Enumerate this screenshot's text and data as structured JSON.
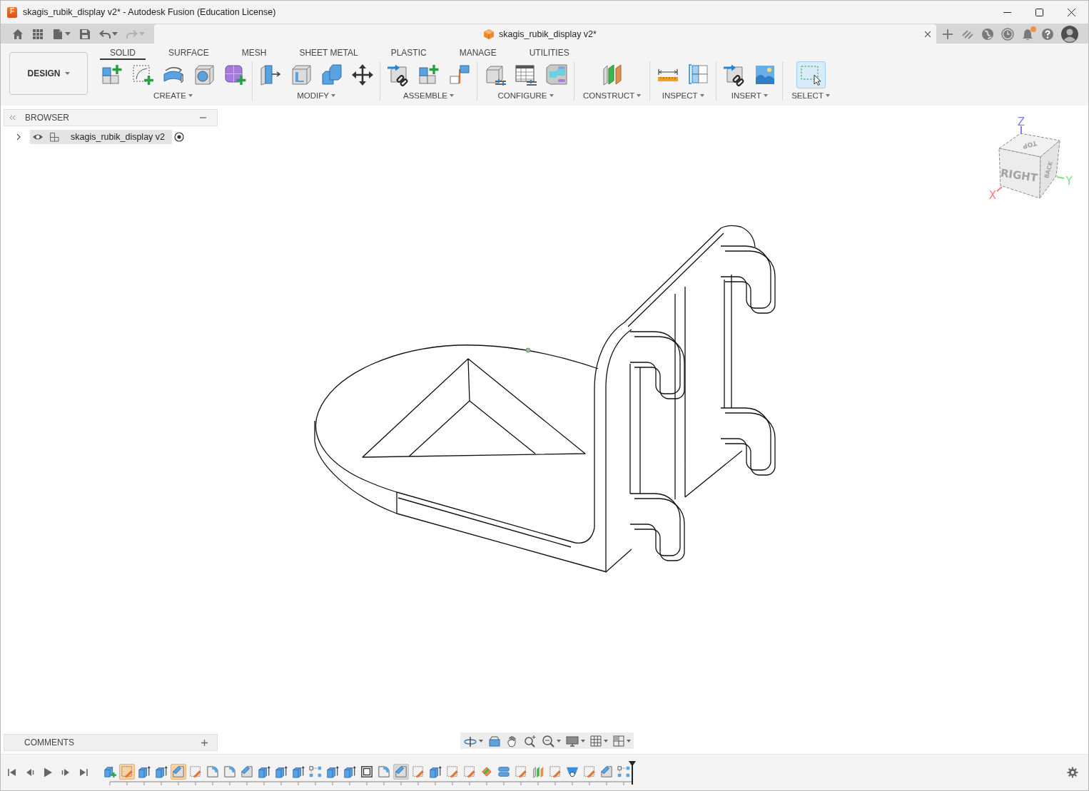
{
  "window": {
    "title": "skagis_rubik_display v2* - Autodesk Fusion (Education License)",
    "icon_letter": "F"
  },
  "quick_access": {
    "undo": {
      "disabled": false
    },
    "redo": {
      "disabled": true
    }
  },
  "document_tab": {
    "title": "skagis_rubik_display v2*"
  },
  "notifications": {
    "unread": true
  },
  "workspace": {
    "label": "DESIGN"
  },
  "toolbar_tabs": [
    {
      "label": "SOLID",
      "selected": true
    },
    {
      "label": "SURFACE",
      "selected": false
    },
    {
      "label": "MESH",
      "selected": false
    },
    {
      "label": "SHEET METAL",
      "selected": false
    },
    {
      "label": "PLASTIC",
      "selected": false
    },
    {
      "label": "MANAGE",
      "selected": false
    },
    {
      "label": "UTILITIES",
      "selected": false
    }
  ],
  "tool_groups": [
    {
      "label": "CREATE",
      "tools": [
        {
          "kind": "new-component",
          "active": false
        },
        {
          "kind": "sketch",
          "active": false
        },
        {
          "kind": "revolve",
          "active": false
        },
        {
          "kind": "hole",
          "active": false
        },
        {
          "kind": "form",
          "active": false
        }
      ]
    },
    {
      "label": "MODIFY",
      "tools": [
        {
          "kind": "press-pull",
          "active": false
        },
        {
          "kind": "shell",
          "active": false
        },
        {
          "kind": "combine",
          "active": false
        },
        {
          "kind": "move",
          "active": false
        }
      ]
    },
    {
      "label": "ASSEMBLE",
      "tools": [
        {
          "kind": "link",
          "active": false
        },
        {
          "kind": "new-component",
          "active": false
        },
        {
          "kind": "joint",
          "active": false
        }
      ]
    },
    {
      "label": "CONFIGURE",
      "tools": [
        {
          "kind": "configure",
          "active": false
        },
        {
          "kind": "table",
          "active": false
        },
        {
          "kind": "theme",
          "active": false
        }
      ]
    },
    {
      "label": "CONSTRUCT",
      "tools": [
        {
          "kind": "plane",
          "active": false
        }
      ]
    },
    {
      "label": "INSPECT",
      "tools": [
        {
          "kind": "measure",
          "active": false
        },
        {
          "kind": "section",
          "active": false
        }
      ]
    },
    {
      "label": "INSERT",
      "tools": [
        {
          "kind": "link",
          "active": false
        },
        {
          "kind": "image",
          "active": false
        }
      ]
    },
    {
      "label": "SELECT",
      "tools": [
        {
          "kind": "select",
          "active": true
        }
      ]
    }
  ],
  "browser": {
    "title": "BROWSER",
    "items": [
      {
        "label": "skagis_rubik_display v2",
        "expanded": false,
        "visible": true,
        "selected": true,
        "active": true
      }
    ]
  },
  "view_cube": {
    "faces": [
      {
        "label": "TOP"
      },
      {
        "label": "RIGHT"
      },
      {
        "label": "BACK"
      }
    ],
    "axes": [
      {
        "label": "Z",
        "color": "#7f7fff"
      },
      {
        "label": "X",
        "color": "#ff7b7b"
      },
      {
        "label": "Y",
        "color": "#7fdc7f"
      }
    ]
  },
  "comments": {
    "title": "COMMENTS"
  },
  "timeline": {
    "items": [
      {
        "kind": "component",
        "selected": false,
        "hovered": false
      },
      {
        "kind": "sketch",
        "selected": true,
        "hovered": false
      },
      {
        "kind": "extrude",
        "selected": false,
        "hovered": false
      },
      {
        "kind": "extrude",
        "selected": false,
        "hovered": false
      },
      {
        "kind": "chamfer",
        "selected": true,
        "hovered": false
      },
      {
        "kind": "sketch",
        "selected": false,
        "hovered": false
      },
      {
        "kind": "fillet",
        "selected": false,
        "hovered": false
      },
      {
        "kind": "fillet",
        "selected": false,
        "hovered": false
      },
      {
        "kind": "chamfer",
        "selected": false,
        "hovered": false
      },
      {
        "kind": "extrude",
        "selected": false,
        "hovered": false
      },
      {
        "kind": "extrude",
        "selected": false,
        "hovered": false
      },
      {
        "kind": "extrude",
        "selected": false,
        "hovered": false
      },
      {
        "kind": "pattern",
        "selected": false,
        "hovered": false
      },
      {
        "kind": "extrude",
        "selected": false,
        "hovered": false
      },
      {
        "kind": "extrude",
        "selected": false,
        "hovered": false
      },
      {
        "kind": "shell",
        "selected": false,
        "hovered": false
      },
      {
        "kind": "fillet",
        "selected": false,
        "hovered": false
      },
      {
        "kind": "chamfer",
        "selected": false,
        "hovered": true
      },
      {
        "kind": "sketch",
        "selected": false,
        "hovered": false
      },
      {
        "kind": "extrude",
        "selected": false,
        "hovered": false
      },
      {
        "kind": "sketch",
        "selected": false,
        "hovered": false
      },
      {
        "kind": "sketch",
        "selected": false,
        "hovered": false
      },
      {
        "kind": "move",
        "selected": false,
        "hovered": false
      },
      {
        "kind": "split",
        "selected": false,
        "hovered": false
      },
      {
        "kind": "sketch",
        "selected": false,
        "hovered": false
      },
      {
        "kind": "plane",
        "selected": false,
        "hovered": false
      },
      {
        "kind": "sketch",
        "selected": false,
        "hovered": false
      },
      {
        "kind": "hole",
        "selected": false,
        "hovered": false
      },
      {
        "kind": "sketch",
        "selected": false,
        "hovered": false
      },
      {
        "kind": "chamfer",
        "selected": false,
        "hovered": false
      },
      {
        "kind": "pattern",
        "selected": false,
        "hovered": false
      }
    ]
  }
}
